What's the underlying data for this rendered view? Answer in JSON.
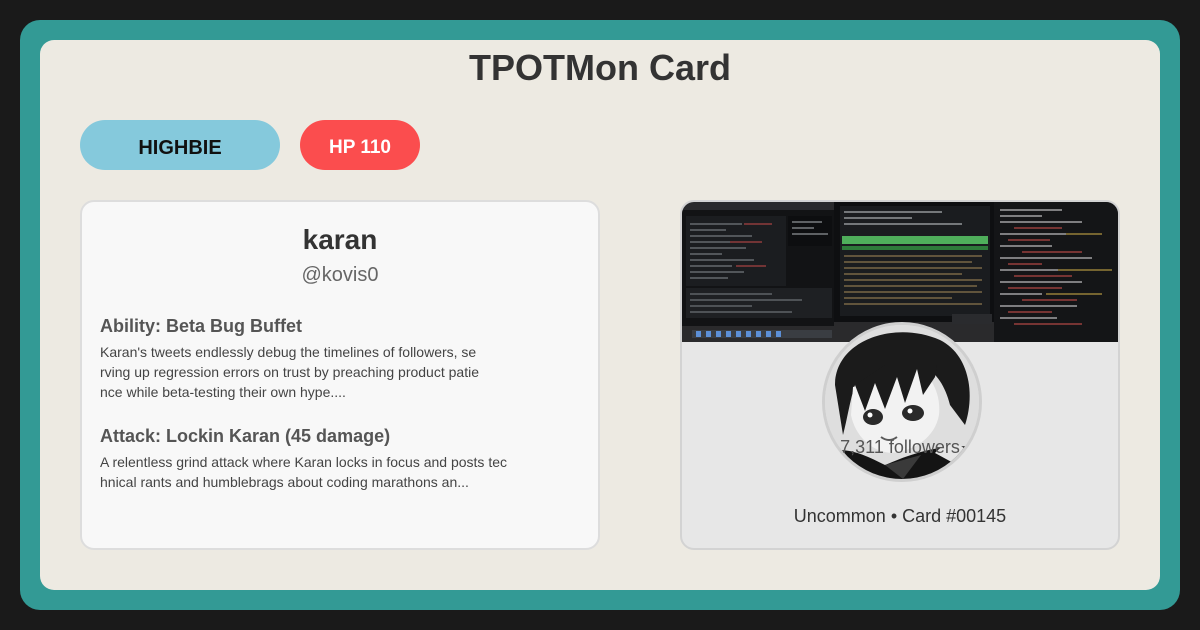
{
  "card": {
    "title": "TPOTMon Card",
    "type_label": "HIGHBIE",
    "hp_label": "HP 110",
    "name": "karan",
    "handle": "@kovis0",
    "ability": {
      "heading": "Ability: Beta Bug Buffet",
      "text": "Karan's tweets endlessly debug the timelines of followers, serving up regression errors on trust by preaching product patience while beta-testing their own hype...."
    },
    "attack": {
      "heading": "Attack: Lockin Karan (45 damage)",
      "text": "A relentless grind attack where Karan locks in focus and posts technical rants and humblebrags about coding marathons an..."
    },
    "followers": "7,311 followers",
    "rarity_line": "Uncommon • Card #00145"
  },
  "colors": {
    "frame": "#339a95",
    "card_bg": "#edeae2",
    "type_pill": "#85c9dc",
    "hp_pill": "#fb4d4e"
  },
  "icons": {
    "banner": "monitors-code-photo",
    "avatar": "anime-portrait-photo"
  }
}
